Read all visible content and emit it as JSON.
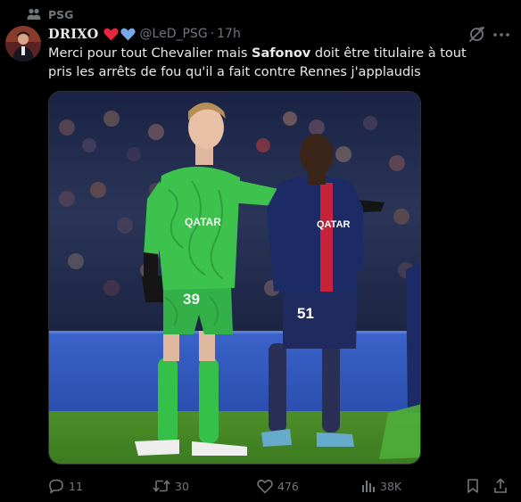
{
  "community": {
    "name": "PSG",
    "icon": "community-icon"
  },
  "tweet": {
    "author_name": "DRIXO",
    "author_emojis": [
      "red-heart",
      "blue-heart"
    ],
    "handle": "@LeD_PSG",
    "separator": "·",
    "time": "17h",
    "text_part1": "Merci pour tout Chevalier mais ",
    "text_bold": "Safonov",
    "text_part2": " doit être titulaire à tout pris les arrêts de fou qu'il a fait contre Rennes j'applaudis",
    "media": {
      "goalkeeper_number": "39",
      "outfield_number": "51",
      "sponsor": "QATAR"
    }
  },
  "actions": {
    "replies": "11",
    "retweets": "30",
    "likes": "476",
    "views": "38K"
  },
  "colors": {
    "background": "#000000",
    "text": "#e7e9ea",
    "secondary": "#71767b",
    "heart_red": "#e8263d",
    "heart_blue": "#7aa7e8",
    "gk_green": "#35c04a",
    "psg_navy": "#1c2a66"
  }
}
